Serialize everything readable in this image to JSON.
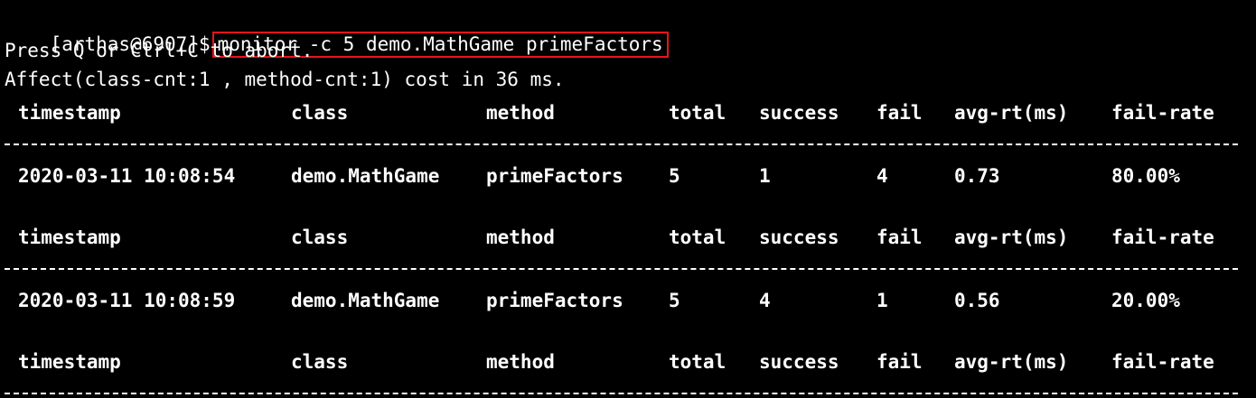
{
  "prompt": "[arthas@6907]$",
  "command": "monitor -c 5 demo.MathGame primeFactors",
  "info_lines": [
    "Press Q or Ctrl+C to abort.",
    "Affect(class-cnt:1 , method-cnt:1) cost in 36 ms."
  ],
  "columns": [
    "timestamp",
    "class",
    "method",
    "total",
    "success",
    "fail",
    "avg-rt(ms)",
    "fail-rate"
  ],
  "records": [
    {
      "timestamp": "2020-03-11 10:08:54",
      "class": "demo.MathGame",
      "method": "primeFactors",
      "total": "5",
      "success": "1",
      "fail": "4",
      "avg_rt": "0.73",
      "fail_rate": "80.00%"
    },
    {
      "timestamp": "2020-03-11 10:08:59",
      "class": "demo.MathGame",
      "method": "primeFactors",
      "total": "5",
      "success": "4",
      "fail": "1",
      "avg_rt": "0.56",
      "fail_rate": "20.00%"
    }
  ],
  "colors": {
    "background": "#000000",
    "text": "#ffffff",
    "highlight_border": "#e8141a"
  }
}
